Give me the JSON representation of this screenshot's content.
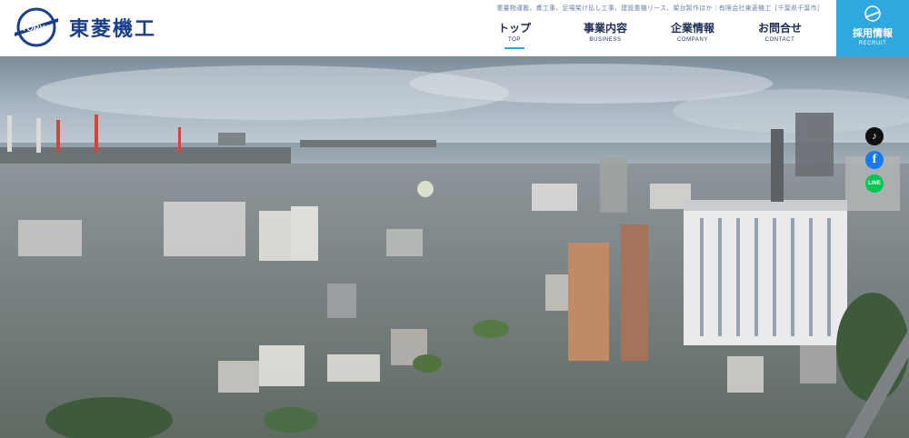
{
  "header": {
    "logo_mark_text": "TORYO",
    "company_name": "東菱機工",
    "tagline": "重量物運搬、鳶工事、足場架け払し工事、建設重機リース、架台製作ほか｜有限会社東菱機工［千葉県千葉市］"
  },
  "nav": {
    "items": [
      {
        "jp": "トップ",
        "en": "TOP"
      },
      {
        "jp": "事業内容",
        "en": "BUSINESS"
      },
      {
        "jp": "企業情報",
        "en": "COMPANY"
      },
      {
        "jp": "お問合せ",
        "en": "CONTACT"
      }
    ],
    "active": "TOP"
  },
  "recruit": {
    "jp": "採用情報",
    "en": "RECRUIT"
  },
  "social": {
    "tiktok": "tiktok-icon",
    "facebook": "f",
    "line": "LINE"
  },
  "colors": {
    "brand": "#1a3f8f",
    "accent": "#2fa8df",
    "nav_text": "#1b2d55"
  }
}
